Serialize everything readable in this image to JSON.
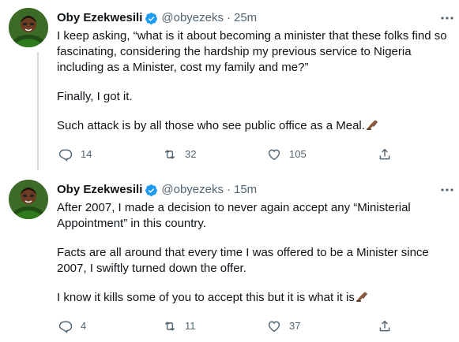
{
  "colors": {
    "text": "#0f1419",
    "secondary": "#536471",
    "verified": "#1d9bf0",
    "thread_line": "#cfd9de"
  },
  "tweets": [
    {
      "author": {
        "display_name": "Oby Ezekwesili",
        "handle": "@obyezeks",
        "verified_icon": "verified-badge-icon"
      },
      "separator": "·",
      "time": "25m",
      "paragraphs": [
        "I keep asking, “what is it about becoming a minister that these folks find so fascinating, considering the hardship my previous service to Nigeria including as a Minister, cost my family and me?”",
        "Finally, I got it.",
        "Such attack is by all those who see public office as a Meal."
      ],
      "trailing_emoji": "writing-hand-emoji",
      "stats": {
        "replies": "14",
        "retweets": "32",
        "likes": "105"
      }
    },
    {
      "author": {
        "display_name": "Oby Ezekwesili",
        "handle": "@obyezeks",
        "verified_icon": "verified-badge-icon"
      },
      "separator": "·",
      "time": "15m",
      "paragraphs": [
        "After 2007, I made a decision to never again accept any “Ministerial Appointment” in this country.",
        "Facts are all around that every time I was offered to be a Minister since 2007, I swiftly turned down the offer.",
        "I know it kills some of you to accept this but it is what it is"
      ],
      "trailing_emoji": "writing-hand-emoji",
      "stats": {
        "replies": "4",
        "retweets": "11",
        "likes": "37"
      }
    }
  ]
}
